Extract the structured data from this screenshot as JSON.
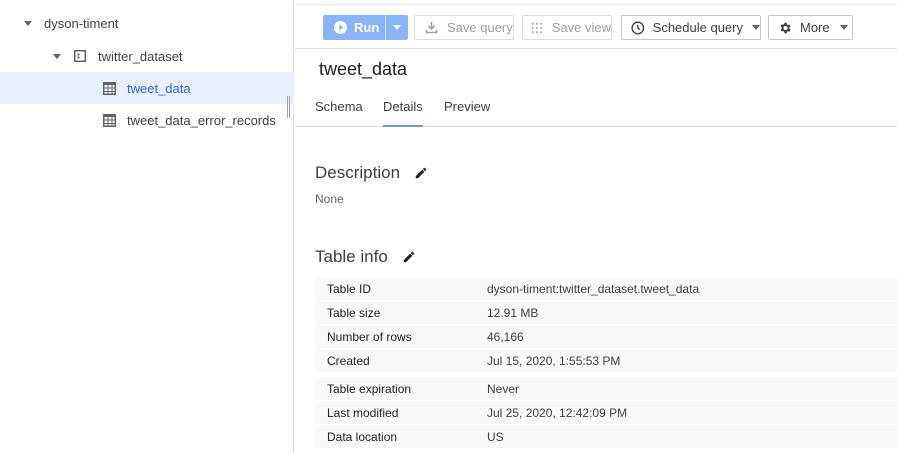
{
  "explorer": {
    "project": "dyson-timent",
    "dataset": "twitter_dataset",
    "tables": [
      {
        "label": "tweet_data",
        "selected": true
      },
      {
        "label": "tweet_data_error_records",
        "selected": false
      }
    ]
  },
  "toolbar": {
    "run_label": "Run",
    "save_query_label": "Save query",
    "save_view_label": "Save view",
    "schedule_label": "Schedule query",
    "more_label": "More"
  },
  "page": {
    "title": "tweet_data",
    "tabs": [
      "Schema",
      "Details",
      "Preview"
    ],
    "active_tab": "Details"
  },
  "description": {
    "heading": "Description",
    "value": "None"
  },
  "table_info": {
    "heading": "Table info",
    "rows": [
      {
        "key": "Table ID",
        "value": "dyson-timent:twitter_dataset.tweet_data"
      },
      {
        "key": "Table size",
        "value": "12.91 MB"
      },
      {
        "key": "Number of rows",
        "value": "46,166"
      },
      {
        "key": "Created",
        "value": "Jul 15, 2020, 1:55:53 PM"
      },
      {
        "key": "Table expiration",
        "value": "Never"
      },
      {
        "key": "Last modified",
        "value": "Jul 25, 2020, 12:42:09 PM"
      },
      {
        "key": "Data location",
        "value": "US"
      }
    ]
  },
  "colors": {
    "accent": "#1a73e8",
    "run_button": "#8ab4f8",
    "selected_row": "#e8f0fe"
  }
}
